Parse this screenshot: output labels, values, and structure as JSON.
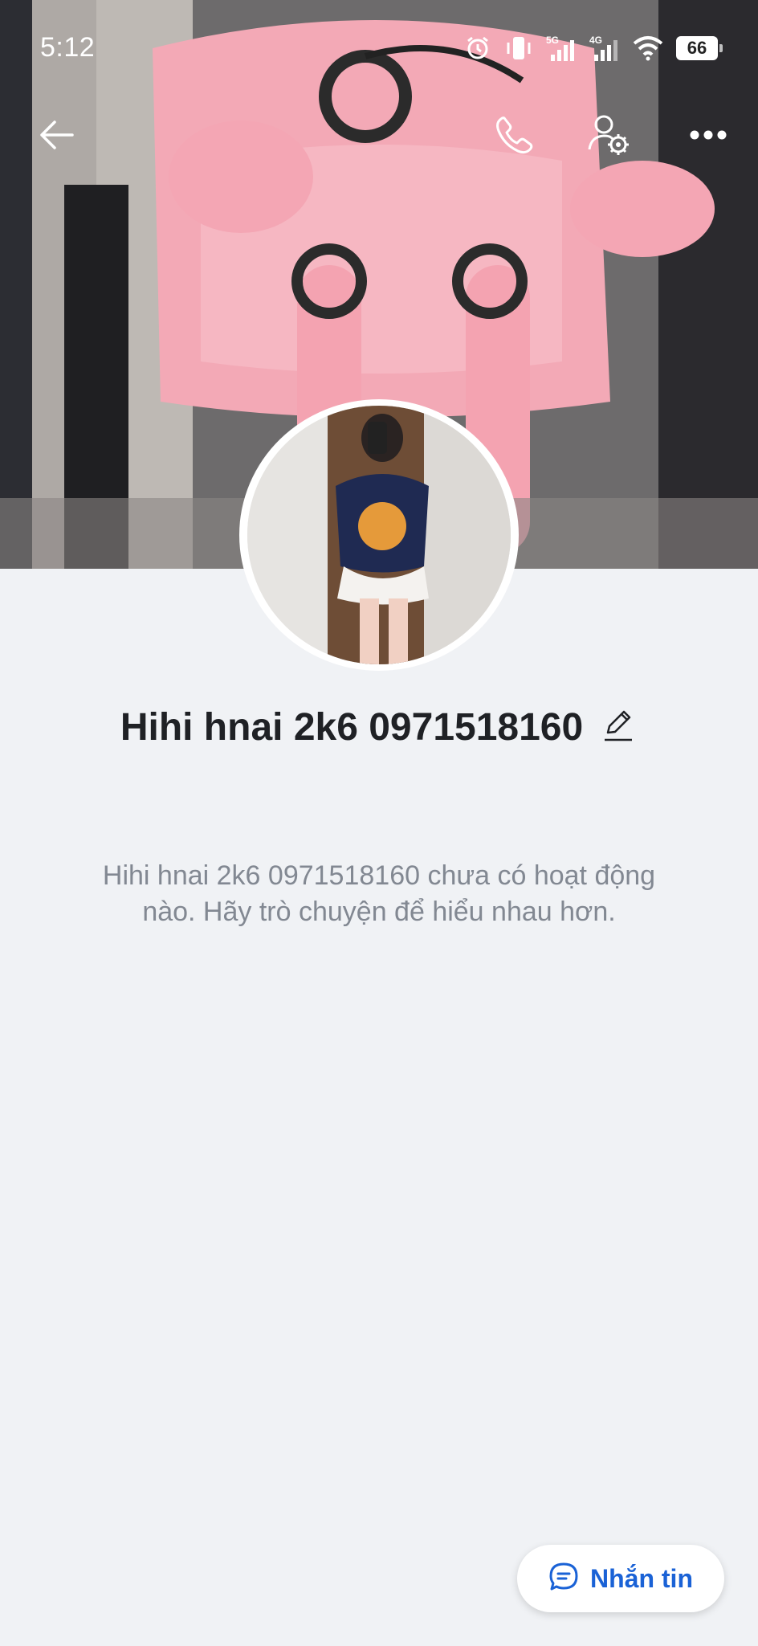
{
  "status_bar": {
    "time": "5:12",
    "network_primary": "5G",
    "network_secondary": "4G",
    "battery": "66",
    "icons": [
      "alarm-icon",
      "vibrate-icon",
      "signal-5g-icon",
      "signal-4g-icon",
      "wifi-icon",
      "battery-icon"
    ]
  },
  "nav": {
    "icons": [
      "back-arrow-icon",
      "phone-icon",
      "user-settings-icon",
      "more-icon"
    ]
  },
  "profile": {
    "name": "Hihi hnai 2k6 0971518160",
    "empty_message": "Hihi hnai 2k6 0971518160 chưa có hoạt động nào. Hãy trò chuyện để hiểu nhau hơn."
  },
  "actions": {
    "message_label": "Nhắn tin",
    "message_icon": "chat-bubble-icon"
  },
  "colors": {
    "background": "#f0f2f5",
    "accent": "#1a62d6",
    "name_text": "#1f2125",
    "muted_text": "#828892",
    "cover_pink": "#f4a9b7"
  }
}
